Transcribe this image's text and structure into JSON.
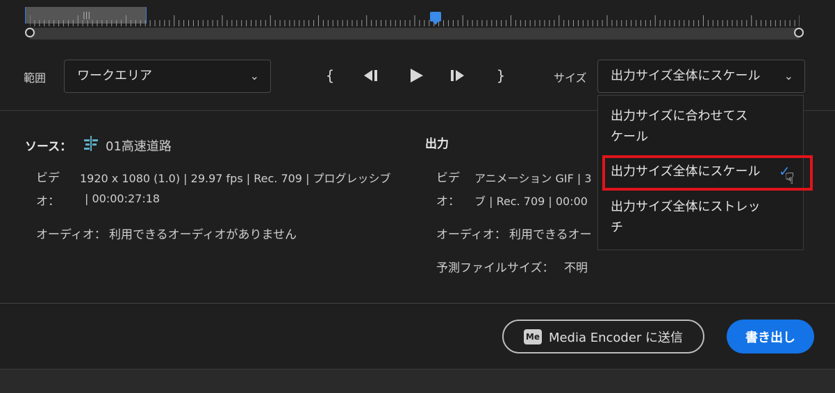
{
  "range": {
    "label": "範囲",
    "value": "ワークエリア"
  },
  "size": {
    "label": "サイズ",
    "value": "出力サイズ全体にスケール",
    "options": [
      "出力サイズに合わせてス",
      "ケール",
      "出力サイズ全体にスケール",
      "出力サイズ全体にストレッ",
      "チ"
    ]
  },
  "source": {
    "title": "ソース：",
    "name": "01高速道路",
    "video_label_1": "ビデ",
    "video_label_2": "オ：",
    "video_line1": "1920 x 1080 (1.0) | 29.97 fps | Rec. 709 | プログレッシブ",
    "video_line2": "| 00:00:27:18",
    "audio_label": "オーディオ：",
    "audio_value": "利用できるオーディオがありません"
  },
  "output": {
    "title": "出力",
    "video_label_1": "ビデ",
    "video_label_2": "オ：",
    "video_line1": "アニメーション GIF | 3",
    "video_line2": "ブ | Rec. 709 | 00:00",
    "audio_label": "オーディオ：",
    "audio_value": "利用できるオー",
    "filesize_label": "予測ファイルサイズ：",
    "filesize_value": "不明"
  },
  "buttons": {
    "media_encoder": "Media Encoder に送信",
    "media_encoder_icon": "Me",
    "export": "書き出し"
  },
  "transport": {
    "in": "{",
    "out": "}"
  }
}
